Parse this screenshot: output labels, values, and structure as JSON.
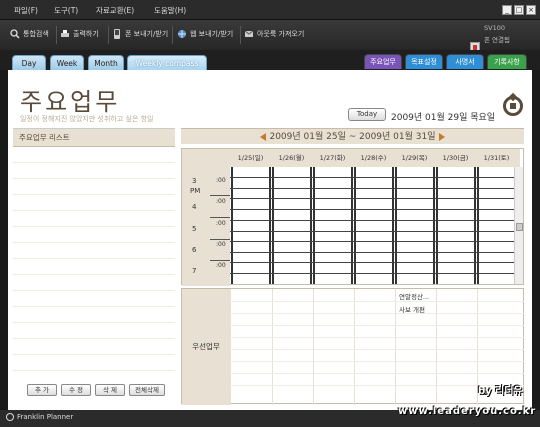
{
  "menu": [
    "파일(F)",
    "도구(T)",
    "자료교환(E)",
    "도움말(H)"
  ],
  "window_buttons": [
    "_",
    "□",
    "×"
  ],
  "toolbar": {
    "items": [
      {
        "label": "통합검색",
        "icon": "search-icon"
      },
      {
        "label": "출력하기",
        "icon": "print-icon"
      },
      {
        "label": "폰 보내기/받기",
        "icon": "phone-sync-icon"
      },
      {
        "label": "웹 보내기/받기",
        "icon": "web-sync-icon"
      },
      {
        "label": "아웃룩 가져오기",
        "icon": "outlook-import-icon"
      }
    ],
    "device_name": "SV100",
    "device_status": "폰 연결됨"
  },
  "tabs": [
    "Day",
    "Week",
    "Month",
    "Weekly compass"
  ],
  "right_tabs": [
    {
      "label": "주요업무",
      "color": "#7a55b8"
    },
    {
      "label": "목표설정",
      "color": "#2e8fd6"
    },
    {
      "label": "사명서",
      "color": "#2e8fd6"
    },
    {
      "label": "기록사항",
      "color": "#3aa24a"
    }
  ],
  "page": {
    "title": "주요업무",
    "subtitle": "일정이 정해지진 않았지만 성취하고 싶은 항일",
    "today_button": "Today",
    "current_date": "2009년 01월 29일 목요일"
  },
  "left_panel": {
    "header": "주요업무 리스트",
    "buttons": [
      "추 가",
      "수 정",
      "삭 제",
      "전체삭제"
    ]
  },
  "week": {
    "range": "2009년 01월 25일 ~ 2009년 01월 31일",
    "days": [
      "1/25(일)",
      "1/26(월)",
      "1/27(화)",
      "1/28(수)",
      "1/29(목)",
      "1/30(금)",
      "1/31(토)"
    ],
    "hours": [
      {
        "hour": "3",
        "ampm": "PM",
        "min": ":00"
      },
      {
        "hour": "4",
        "ampm": "",
        "min": ":00"
      },
      {
        "hour": "5",
        "ampm": "",
        "min": ":00"
      },
      {
        "hour": "6",
        "ampm": "",
        "min": ":00"
      },
      {
        "hour": "7",
        "ampm": "",
        "min": ":00"
      }
    ]
  },
  "priority": {
    "label": "우선업무",
    "tasks": [
      "연말정산...",
      "사보 개편"
    ]
  },
  "statusbar": {
    "brand": "Franklin Planner"
  },
  "watermark": {
    "line1": "by 리더유",
    "line2": "www.leaderyou.co.kr"
  }
}
